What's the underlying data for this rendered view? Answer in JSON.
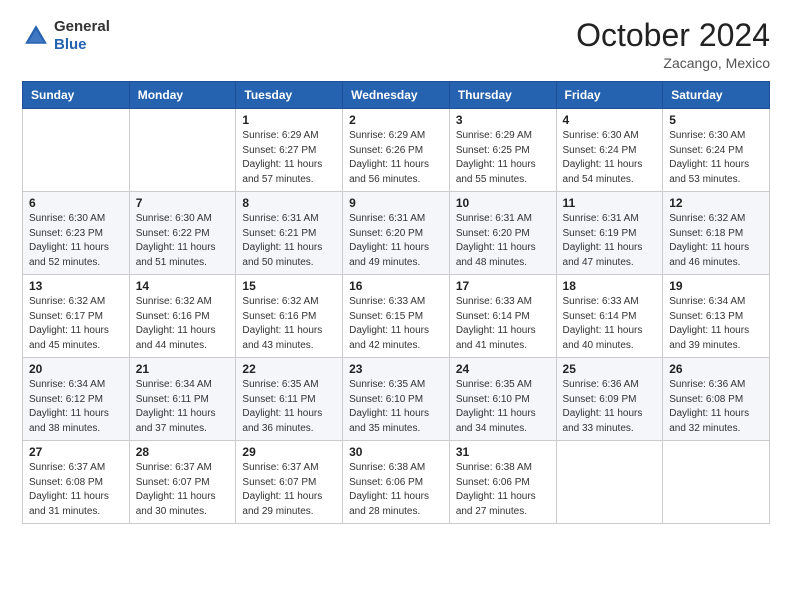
{
  "header": {
    "logo_general": "General",
    "logo_blue": "Blue",
    "month": "October 2024",
    "location": "Zacango, Mexico"
  },
  "weekdays": [
    "Sunday",
    "Monday",
    "Tuesday",
    "Wednesday",
    "Thursday",
    "Friday",
    "Saturday"
  ],
  "weeks": [
    [
      {
        "day": "",
        "info": ""
      },
      {
        "day": "",
        "info": ""
      },
      {
        "day": "1",
        "info": "Sunrise: 6:29 AM\nSunset: 6:27 PM\nDaylight: 11 hours and 57 minutes."
      },
      {
        "day": "2",
        "info": "Sunrise: 6:29 AM\nSunset: 6:26 PM\nDaylight: 11 hours and 56 minutes."
      },
      {
        "day": "3",
        "info": "Sunrise: 6:29 AM\nSunset: 6:25 PM\nDaylight: 11 hours and 55 minutes."
      },
      {
        "day": "4",
        "info": "Sunrise: 6:30 AM\nSunset: 6:24 PM\nDaylight: 11 hours and 54 minutes."
      },
      {
        "day": "5",
        "info": "Sunrise: 6:30 AM\nSunset: 6:24 PM\nDaylight: 11 hours and 53 minutes."
      }
    ],
    [
      {
        "day": "6",
        "info": "Sunrise: 6:30 AM\nSunset: 6:23 PM\nDaylight: 11 hours and 52 minutes."
      },
      {
        "day": "7",
        "info": "Sunrise: 6:30 AM\nSunset: 6:22 PM\nDaylight: 11 hours and 51 minutes."
      },
      {
        "day": "8",
        "info": "Sunrise: 6:31 AM\nSunset: 6:21 PM\nDaylight: 11 hours and 50 minutes."
      },
      {
        "day": "9",
        "info": "Sunrise: 6:31 AM\nSunset: 6:20 PM\nDaylight: 11 hours and 49 minutes."
      },
      {
        "day": "10",
        "info": "Sunrise: 6:31 AM\nSunset: 6:20 PM\nDaylight: 11 hours and 48 minutes."
      },
      {
        "day": "11",
        "info": "Sunrise: 6:31 AM\nSunset: 6:19 PM\nDaylight: 11 hours and 47 minutes."
      },
      {
        "day": "12",
        "info": "Sunrise: 6:32 AM\nSunset: 6:18 PM\nDaylight: 11 hours and 46 minutes."
      }
    ],
    [
      {
        "day": "13",
        "info": "Sunrise: 6:32 AM\nSunset: 6:17 PM\nDaylight: 11 hours and 45 minutes."
      },
      {
        "day": "14",
        "info": "Sunrise: 6:32 AM\nSunset: 6:16 PM\nDaylight: 11 hours and 44 minutes."
      },
      {
        "day": "15",
        "info": "Sunrise: 6:32 AM\nSunset: 6:16 PM\nDaylight: 11 hours and 43 minutes."
      },
      {
        "day": "16",
        "info": "Sunrise: 6:33 AM\nSunset: 6:15 PM\nDaylight: 11 hours and 42 minutes."
      },
      {
        "day": "17",
        "info": "Sunrise: 6:33 AM\nSunset: 6:14 PM\nDaylight: 11 hours and 41 minutes."
      },
      {
        "day": "18",
        "info": "Sunrise: 6:33 AM\nSunset: 6:14 PM\nDaylight: 11 hours and 40 minutes."
      },
      {
        "day": "19",
        "info": "Sunrise: 6:34 AM\nSunset: 6:13 PM\nDaylight: 11 hours and 39 minutes."
      }
    ],
    [
      {
        "day": "20",
        "info": "Sunrise: 6:34 AM\nSunset: 6:12 PM\nDaylight: 11 hours and 38 minutes."
      },
      {
        "day": "21",
        "info": "Sunrise: 6:34 AM\nSunset: 6:11 PM\nDaylight: 11 hours and 37 minutes."
      },
      {
        "day": "22",
        "info": "Sunrise: 6:35 AM\nSunset: 6:11 PM\nDaylight: 11 hours and 36 minutes."
      },
      {
        "day": "23",
        "info": "Sunrise: 6:35 AM\nSunset: 6:10 PM\nDaylight: 11 hours and 35 minutes."
      },
      {
        "day": "24",
        "info": "Sunrise: 6:35 AM\nSunset: 6:10 PM\nDaylight: 11 hours and 34 minutes."
      },
      {
        "day": "25",
        "info": "Sunrise: 6:36 AM\nSunset: 6:09 PM\nDaylight: 11 hours and 33 minutes."
      },
      {
        "day": "26",
        "info": "Sunrise: 6:36 AM\nSunset: 6:08 PM\nDaylight: 11 hours and 32 minutes."
      }
    ],
    [
      {
        "day": "27",
        "info": "Sunrise: 6:37 AM\nSunset: 6:08 PM\nDaylight: 11 hours and 31 minutes."
      },
      {
        "day": "28",
        "info": "Sunrise: 6:37 AM\nSunset: 6:07 PM\nDaylight: 11 hours and 30 minutes."
      },
      {
        "day": "29",
        "info": "Sunrise: 6:37 AM\nSunset: 6:07 PM\nDaylight: 11 hours and 29 minutes."
      },
      {
        "day": "30",
        "info": "Sunrise: 6:38 AM\nSunset: 6:06 PM\nDaylight: 11 hours and 28 minutes."
      },
      {
        "day": "31",
        "info": "Sunrise: 6:38 AM\nSunset: 6:06 PM\nDaylight: 11 hours and 27 minutes."
      },
      {
        "day": "",
        "info": ""
      },
      {
        "day": "",
        "info": ""
      }
    ]
  ]
}
